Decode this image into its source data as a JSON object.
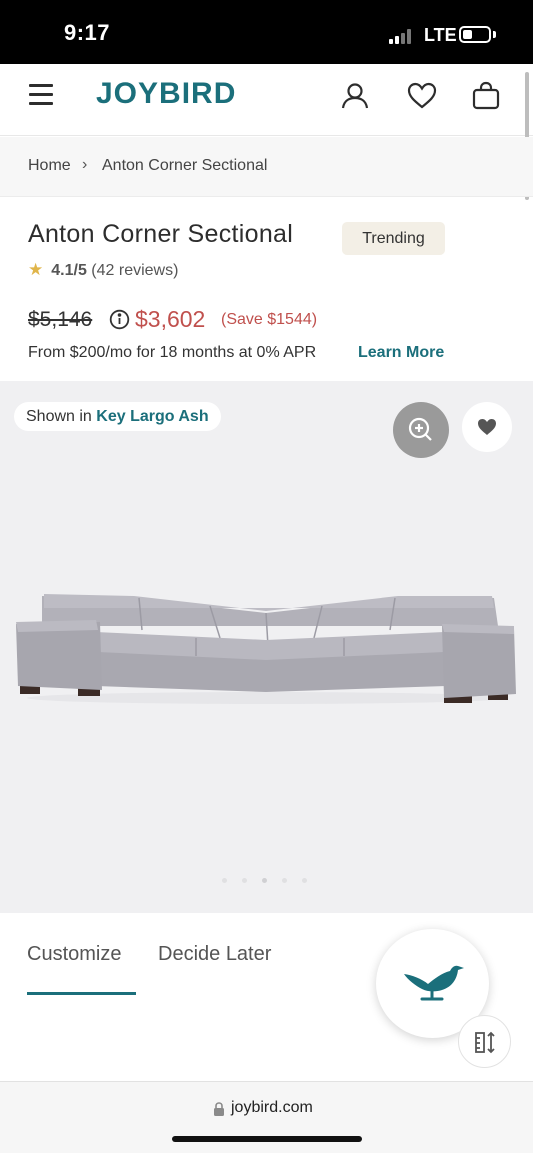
{
  "status_bar": {
    "time": "9:17",
    "network": "LTE"
  },
  "header": {
    "logo": "JOYBIRD"
  },
  "breadcrumb": {
    "items": [
      "Home",
      "Anton Corner Sectional"
    ],
    "separator": "›"
  },
  "product": {
    "title": "Anton Corner Sectional",
    "badge": "Trending",
    "rating": "4.1/5",
    "reviews": "(42 reviews)",
    "old_price": "$5,146",
    "price": "$3,602",
    "save": "(Save $1544)",
    "financing": "From $200/mo for 18 months at 0% APR",
    "learn_more": "Learn More"
  },
  "hero": {
    "shown_in_label": "Shown in",
    "color_name": "Key Largo Ash",
    "carousel_count": 5,
    "carousel_active_index": 2
  },
  "tabs": [
    "Customize",
    "Decide Later"
  ],
  "browser": {
    "url": "joybird.com"
  },
  "colors": {
    "brand": "#1b6f7b",
    "sale": "#c0504d",
    "badge_bg": "#f3efe6",
    "star": "#e0b54a"
  }
}
